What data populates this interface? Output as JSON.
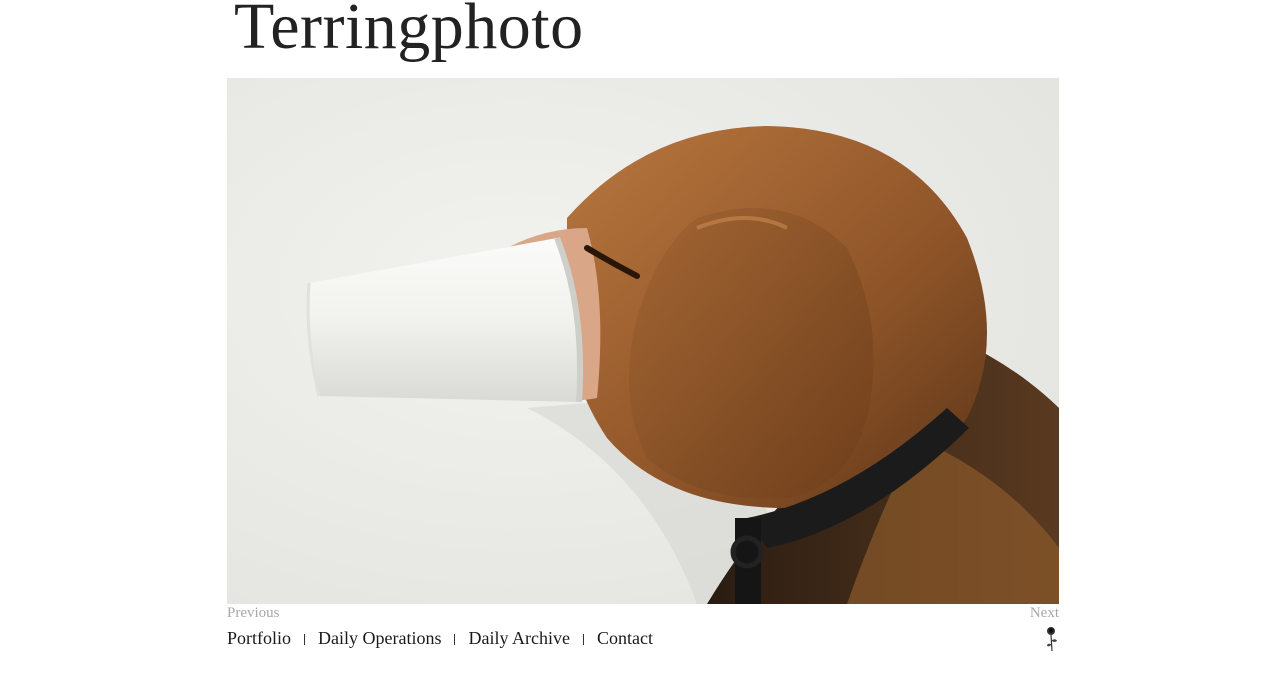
{
  "site": {
    "title": "Terringphoto"
  },
  "photo": {
    "subject": "beagle-with-paper-cup-icon",
    "background_color": "#ececea"
  },
  "pager": {
    "previous_label": "Previous",
    "next_label": "Next"
  },
  "nav": {
    "items": [
      {
        "label": "Portfolio"
      },
      {
        "label": "Daily Operations"
      },
      {
        "label": "Daily Archive"
      },
      {
        "label": "Contact"
      }
    ]
  },
  "icons": {
    "footer_icon": "rose-icon"
  },
  "colors": {
    "text": "#1a1a1a",
    "muted": "#a8a8a8"
  }
}
